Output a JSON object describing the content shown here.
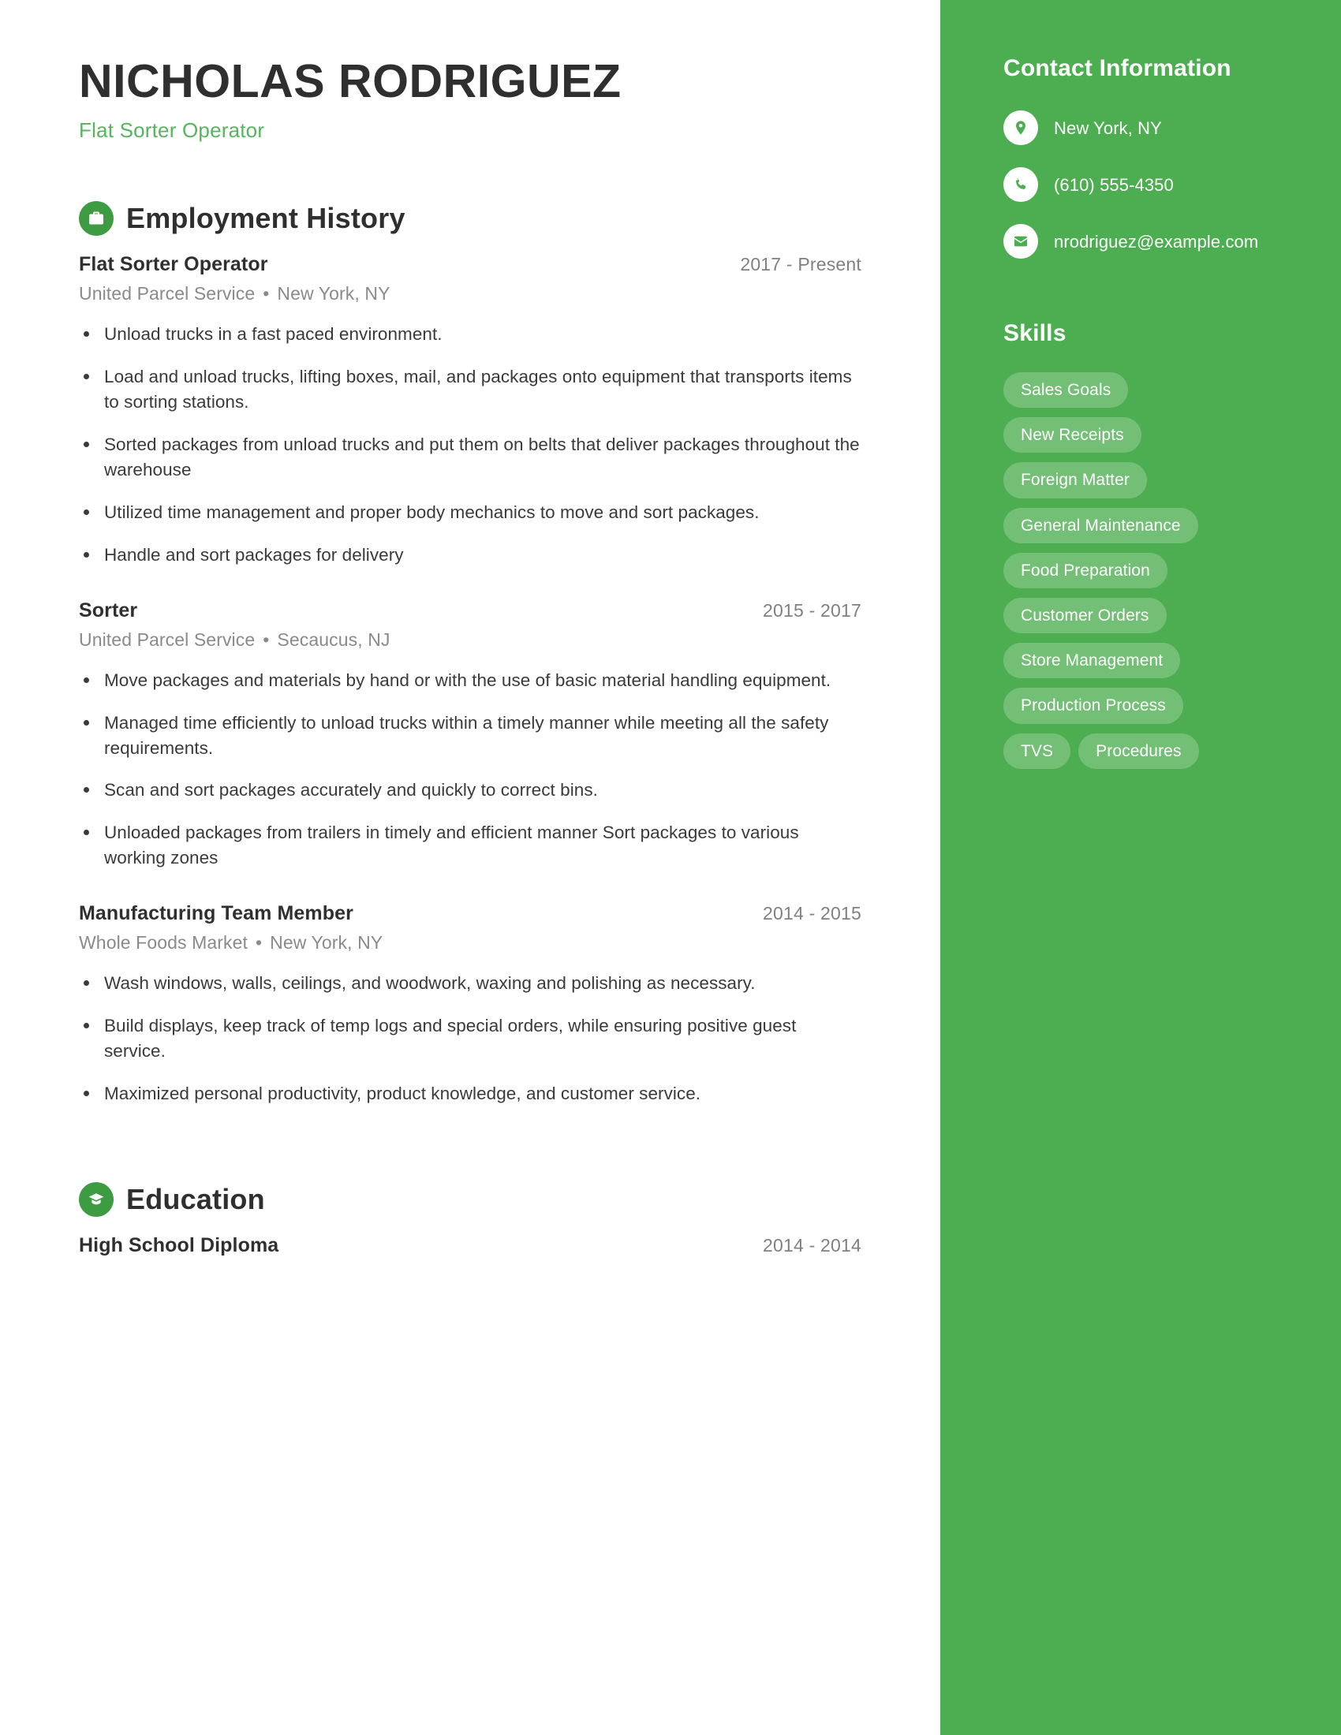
{
  "header": {
    "name": "NICHOLAS RODRIGUEZ",
    "job_title": "Flat Sorter Operator"
  },
  "theme": {
    "sidebar_green": "#4cae50",
    "icon_green": "#3d9c42",
    "subtitle_green": "#57b45f",
    "text_dark": "#2f2f2f",
    "text_muted": "#8a8a8a"
  },
  "sections": {
    "employment": {
      "title": "Employment History",
      "icon": "briefcase-icon",
      "entries": [
        {
          "title": "Flat Sorter Operator",
          "dates": "2017 - Present",
          "company": "United Parcel Service",
          "location": "New York, NY",
          "bullets": [
            "Unload trucks in a fast paced environment.",
            "Load and unload trucks, lifting boxes, mail, and packages onto equipment that transports items to sorting stations.",
            "Sorted packages from unload trucks and put them on belts that deliver packages throughout the warehouse",
            "Utilized time management and proper body mechanics to move and sort packages.",
            "Handle and sort packages for delivery"
          ]
        },
        {
          "title": "Sorter",
          "dates": "2015 - 2017",
          "company": "United Parcel Service",
          "location": "Secaucus, NJ",
          "bullets": [
            "Move packages and materials by hand or with the use of basic material handling equipment.",
            "Managed time efficiently to unload trucks within a timely manner while meeting all the safety requirements.",
            "Scan and sort packages accurately and quickly to correct bins.",
            "Unloaded packages from trailers in timely and efficient manner Sort packages to various working zones"
          ]
        },
        {
          "title": "Manufacturing Team Member",
          "dates": "2014 - 2015",
          "company": "Whole Foods Market",
          "location": "New York, NY",
          "bullets": [
            "Wash windows, walls, ceilings, and woodwork, waxing and polishing as necessary.",
            "Build displays, keep track of temp logs and special orders, while ensuring positive guest service.",
            "Maximized personal productivity, product knowledge, and customer service."
          ]
        }
      ]
    },
    "education": {
      "title": "Education",
      "icon": "graduation-cap-icon",
      "entries": [
        {
          "title": "High School Diploma",
          "dates": "2014 - 2014"
        }
      ]
    }
  },
  "sidebar": {
    "contact": {
      "title": "Contact Information",
      "items": [
        {
          "icon": "location-pin-icon",
          "value": "New York, NY"
        },
        {
          "icon": "phone-icon",
          "value": "(610) 555-4350"
        },
        {
          "icon": "envelope-icon",
          "value": "nrodriguez@example.com"
        }
      ]
    },
    "skills": {
      "title": "Skills",
      "items": [
        "Sales Goals",
        "New Receipts",
        "Foreign Matter",
        "General Maintenance",
        "Food Preparation",
        "Customer Orders",
        "Store Management",
        "Production Process",
        "TVS",
        "Procedures"
      ]
    }
  },
  "separator": "•"
}
